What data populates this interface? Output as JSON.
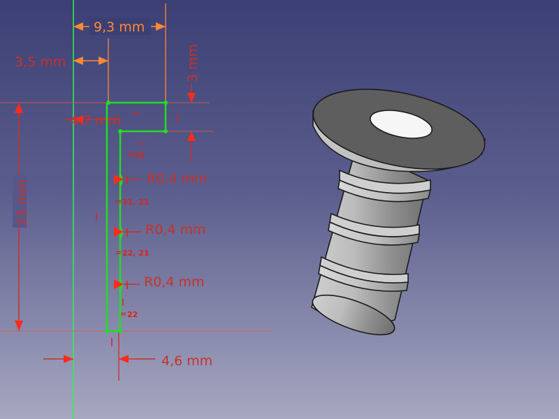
{
  "sketch": {
    "dimensions": {
      "width_total": "9,3 mm",
      "offset_left": "3,5 mm",
      "flange_height": "3 mm",
      "inner_width": "4,7 mm",
      "total_height": "23 mm",
      "bottom_width": "4,6 mm"
    },
    "radii": {
      "r1": "R0,4 mm",
      "r2": "R0,4 mm",
      "r3": "R0,4 mm"
    },
    "constraints": {
      "c_equal_31": "31",
      "c_equal_31_21": "31, 21",
      "c_equal_22_21": "22, 21",
      "c_equal_22": "22"
    }
  },
  "colors": {
    "background_top": "#3c3f74",
    "background_bottom": "#a6a8c0",
    "sketch_geometry": "#22dd22",
    "dimension_red": "#c8312a",
    "dimension_orange": "#ff8a33",
    "model_grey": "#b4b4b4"
  },
  "icons": {
    "radius_marker": "triangle-arrow",
    "equal_constraint": "equal-sign"
  }
}
